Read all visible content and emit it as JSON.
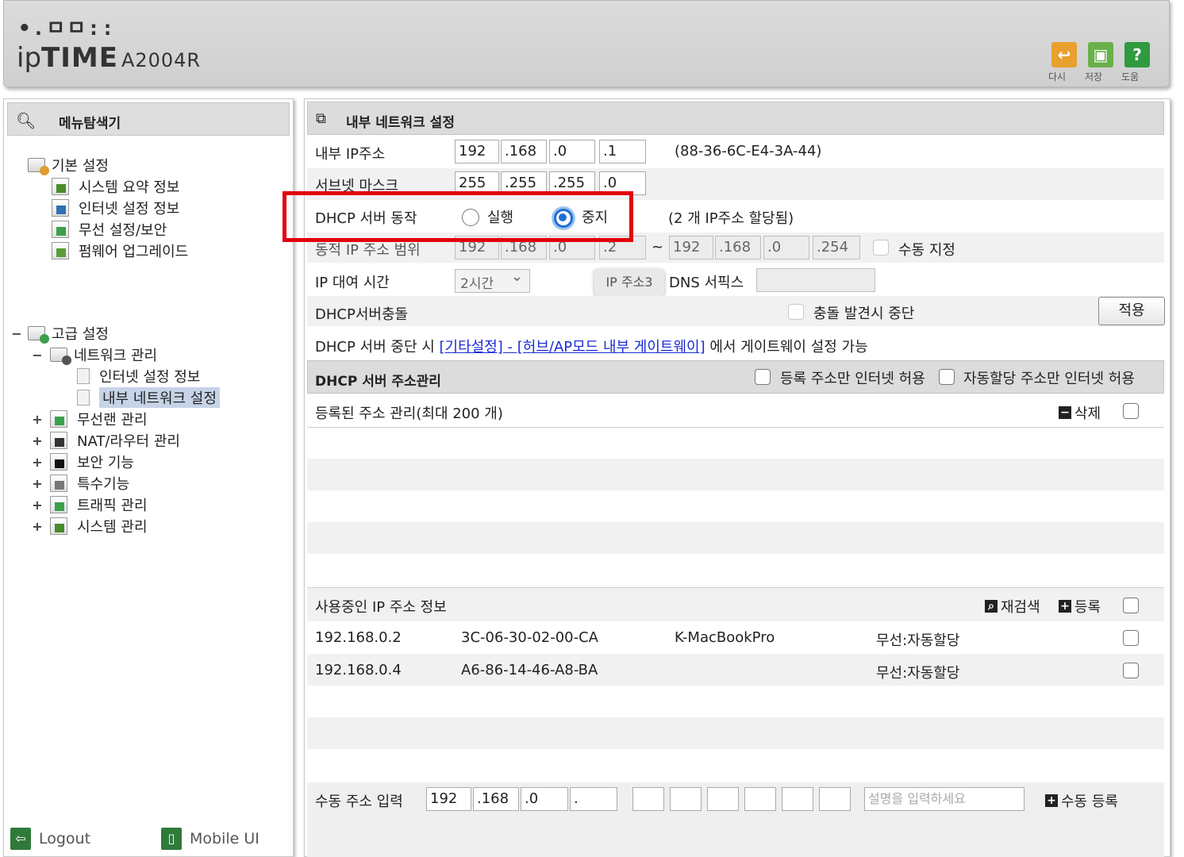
{
  "header": {
    "logo_top": "•.ㅁㅁ::",
    "brand_a": "ip",
    "brand_b": "TIME",
    "model": "A2004R",
    "buttons": [
      {
        "label": "다시",
        "icon": "↩",
        "color": "#e8a02e"
      },
      {
        "label": "저장",
        "icon": "▣",
        "color": "#6ab04c"
      },
      {
        "label": "도움",
        "icon": "?",
        "color": "#2f9a3e"
      }
    ]
  },
  "sidebar": {
    "title": "메뉴탐색기",
    "basic": {
      "label": "기본 설정",
      "items": [
        "시스템 요약 정보",
        "인터넷 설정 정보",
        "무선 설정/보안",
        "펌웨어 업그레이드"
      ]
    },
    "advanced": {
      "expander": "−",
      "label": "고급 설정",
      "network": {
        "expander": "−",
        "label": "네트워크 관리",
        "items": [
          "인터넷 설정 정보",
          "내부 네트워크 설정"
        ]
      },
      "groups": [
        {
          "expander": "+",
          "label": "무선랜 관리"
        },
        {
          "expander": "+",
          "label": "NAT/라우터 관리"
        },
        {
          "expander": "+",
          "label": "보안 기능"
        },
        {
          "expander": "+",
          "label": "특수기능"
        },
        {
          "expander": "+",
          "label": "트래픽 관리"
        },
        {
          "expander": "+",
          "label": "시스템 관리"
        }
      ]
    },
    "footer": {
      "logout": "Logout",
      "mobile": "Mobile UI"
    }
  },
  "main": {
    "title": "내부 네트워크 설정",
    "internal_ip": {
      "label": "내부 IP주소",
      "octets": [
        "192",
        ".168",
        ".0",
        ".1"
      ],
      "mac": "(88-36-6C-E4-3A-44)"
    },
    "subnet": {
      "label": "서브넷 마스크",
      "octets": [
        "255",
        ".255",
        ".255",
        ".0"
      ]
    },
    "dhcp": {
      "label": "DHCP 서버 동작",
      "run": "실행",
      "stop": "중지",
      "assigned": "(2 개 IP주소 할당됨)"
    },
    "dynamic_range": {
      "label": "동적 IP 주소 범위",
      "start": [
        "192",
        ".168",
        ".0",
        ".2"
      ],
      "sep": "~",
      "end": [
        "192",
        ".168",
        ".0",
        ".254"
      ],
      "manual": "수동 지정"
    },
    "lease": {
      "label": "IP 대여 시간",
      "value": "2시간",
      "tooltip": "IP 주소3",
      "dns_label": "DNS 서픽스"
    },
    "conflict": {
      "label": "DHCP서버충돌",
      "option": "충돌 발견시 중단",
      "apply": "적용"
    },
    "note": {
      "prefix": "DHCP 서버 중단 시 ",
      "link": "[기타설정] - [허브/AP모드 내부 게이트웨이]",
      "suffix": " 에서 게이트웨이 설정 가능"
    },
    "addr_mgmt": {
      "title": "DHCP 서버 주소관리",
      "opt_registered": "등록 주소만 인터넷 허용",
      "opt_auto": "자동할당 주소만 인터넷 허용"
    },
    "registered": {
      "label": "등록된 주소 관리(최대 200 개)",
      "delete": "삭제"
    },
    "in_use": {
      "label": "사용중인 IP 주소 정보",
      "rescan": "재검색",
      "register": "등록",
      "rows": [
        {
          "ip": "192.168.0.2",
          "mac": "3C-06-30-02-00-CA",
          "name": "K-MacBookPro",
          "type": "무선:자동할당"
        },
        {
          "ip": "192.168.0.4",
          "mac": "A6-86-14-46-A8-BA",
          "name": "",
          "type": "무선:자동할당"
        }
      ]
    },
    "manual_entry": {
      "label": "수동 주소 입력",
      "octets": [
        "192",
        ".168",
        ".0",
        "."
      ],
      "desc_placeholder": "설명을 입력하세요",
      "button": "수동 등록"
    }
  }
}
